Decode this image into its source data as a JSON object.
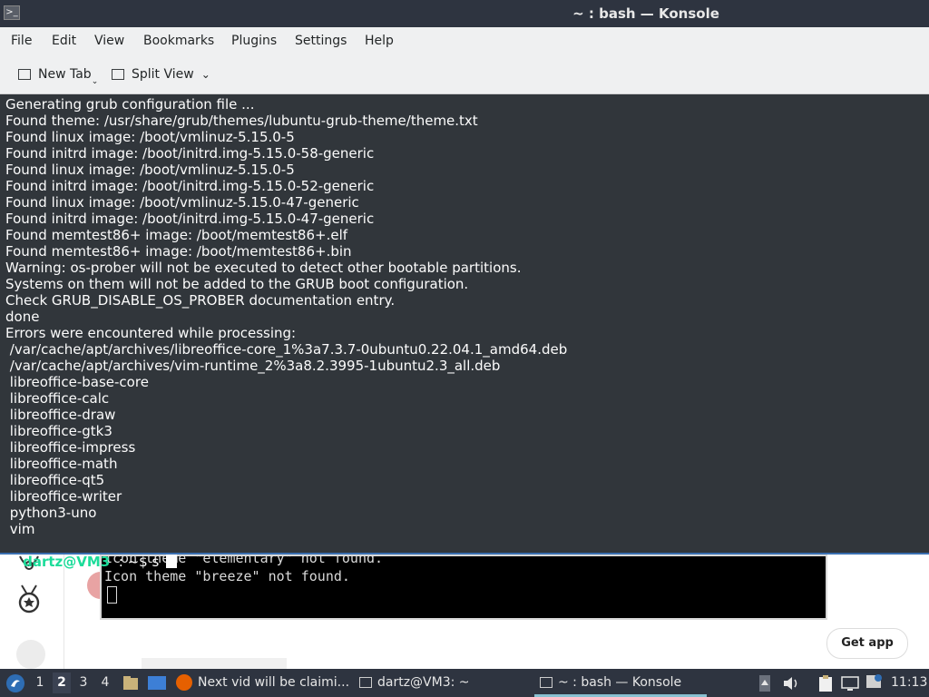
{
  "window": {
    "title": "~ : bash — Konsole"
  },
  "menubar": [
    "File",
    "Edit",
    "View",
    "Bookmarks",
    "Plugins",
    "Settings",
    "Help"
  ],
  "toolbar": {
    "new_tab": "New Tab",
    "split_view": "Split View"
  },
  "terminal": {
    "lines": [
      "Generating grub configuration file ...",
      "Found theme: /usr/share/grub/themes/lubuntu-grub-theme/theme.txt",
      "Found linux image: /boot/vmlinuz-5.15.0-5",
      "Found initrd image: /boot/initrd.img-5.15.0-58-generic",
      "Found linux image: /boot/vmlinuz-5.15.0-5",
      "Found initrd image: /boot/initrd.img-5.15.0-52-generic",
      "Found linux image: /boot/vmlinuz-5.15.0-47-generic",
      "Found initrd image: /boot/initrd.img-5.15.0-47-generic",
      "Found memtest86+ image: /boot/memtest86+.elf",
      "Found memtest86+ image: /boot/memtest86+.bin",
      "Warning: os-prober will not be executed to detect other bootable partitions.",
      "Systems on them will not be added to the GRUB boot configuration.",
      "Check GRUB_DISABLE_OS_PROBER documentation entry.",
      "done",
      "Errors were encountered while processing:",
      " /var/cache/apt/archives/libreoffice-core_1%3a7.3.7-0ubuntu0.22.04.1_amd64.deb",
      " /var/cache/apt/archives/vim-runtime_2%3a8.2.3995-1ubuntu2.3_all.deb",
      " libreoffice-base-core",
      " libreoffice-calc",
      " libreoffice-draw",
      " libreoffice-gtk3",
      " libreoffice-impress",
      " libreoffice-math",
      " libreoffice-qt5",
      " libreoffice-writer",
      " python3-uno",
      " vim"
    ],
    "prompt_user": "dartz@VM3",
    "prompt_rest": "  : ~$ s"
  },
  "background_app": {
    "inner_terminal_lines": [
      "Icon theme \"elementary\" not found.",
      "Icon theme \"breeze\" not found."
    ],
    "get_app": "Get app"
  },
  "taskbar": {
    "workspaces": [
      "1",
      "2",
      "3",
      "4"
    ],
    "active_workspace": "2",
    "tasks": [
      "Next vid will be claimi...",
      "dartz@VM3: ~",
      "~ : bash — Konsole"
    ],
    "clock": "11:13"
  },
  "colors": {
    "terminal_bg": "#31363b",
    "prompt_user": "#1cdc9a",
    "panel_bg": "#2e3440"
  }
}
